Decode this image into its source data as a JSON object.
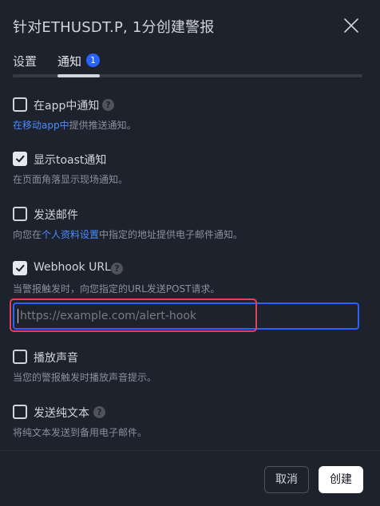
{
  "dialog": {
    "title": "针对ETHUSDT.P, 1分创建警报",
    "close_icon": "close-icon"
  },
  "tabs": [
    {
      "label": "设置",
      "active": false
    },
    {
      "label": "通知",
      "active": true,
      "badge": "1"
    }
  ],
  "options": {
    "app": {
      "label": "在app中通知",
      "checked": false,
      "help": "?",
      "desc_link": "在移动app中",
      "desc_text": "提供推送通知。"
    },
    "toast": {
      "label": "显示toast通知",
      "checked": true,
      "desc_text": "在页面角落显示现场通知。"
    },
    "email": {
      "label": "发送邮件",
      "checked": false,
      "desc_prefix": "向您在",
      "desc_link": "个人资料设置",
      "desc_suffix": "中指定的地址提供电子邮件通知。"
    },
    "webhook": {
      "label": "Webhook URL",
      "checked": true,
      "help": "?",
      "desc_text": "当警报触发时，向您指定的URL发送POST请求。",
      "input_value": "",
      "input_placeholder": "https://example.com/alert-hook"
    },
    "sound": {
      "label": "播放声音",
      "checked": false,
      "desc_text": "当您的警报触发时播放声音提示。"
    },
    "plaintext": {
      "label": "发送纯文本",
      "checked": false,
      "help": "?",
      "desc_text": "将纯文本发送到备用电子邮件。"
    }
  },
  "footer": {
    "cancel_label": "取消",
    "create_label": "创建"
  },
  "colors": {
    "background": "#1e222d",
    "accent": "#2962ff",
    "link": "#4a8cff",
    "highlight": "#e0425a"
  }
}
